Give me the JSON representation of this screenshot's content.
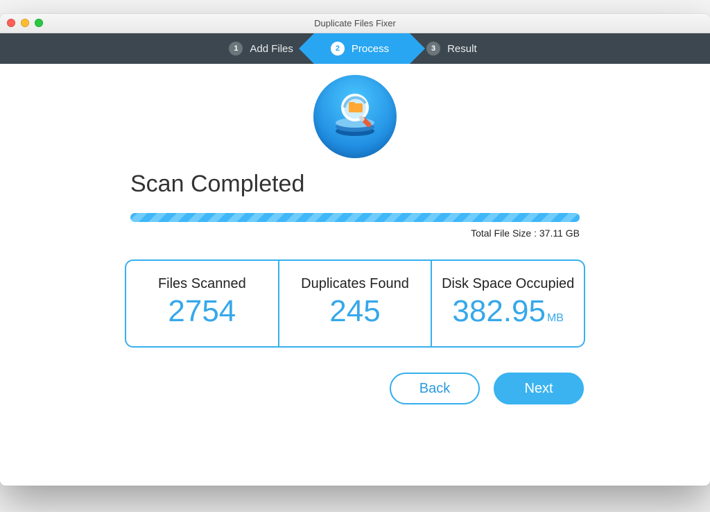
{
  "window": {
    "title": "Duplicate Files Fixer"
  },
  "steps": {
    "one": {
      "num": "1",
      "label": "Add Files"
    },
    "two": {
      "num": "2",
      "label": "Process"
    },
    "three": {
      "num": "3",
      "label": "Result"
    }
  },
  "heading": "Scan Completed",
  "total_file_size": "Total File Size : 37.11 GB",
  "stats": {
    "files_scanned": {
      "label": "Files Scanned",
      "value": "2754"
    },
    "duplicates": {
      "label": "Duplicates Found",
      "value": "245"
    },
    "disk_space": {
      "label": "Disk Space Occupied",
      "value": "382.95",
      "unit": "MB"
    }
  },
  "buttons": {
    "back": "Back",
    "next": "Next"
  },
  "colors": {
    "accent": "#36b0ee",
    "header": "#3c474f"
  }
}
